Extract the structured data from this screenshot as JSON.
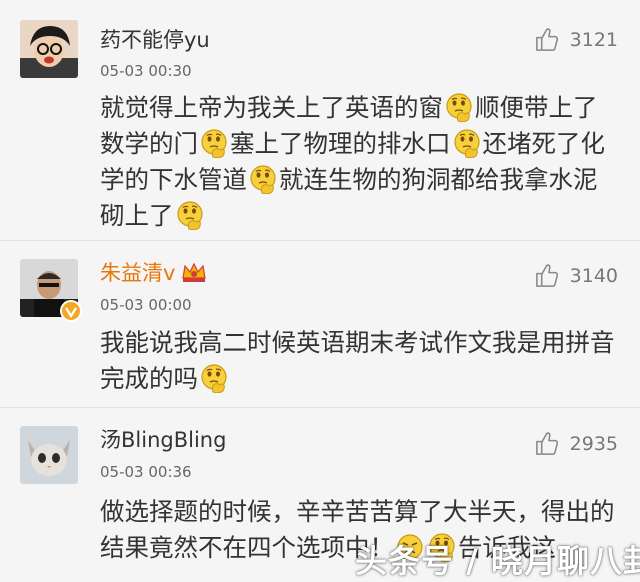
{
  "comments": [
    {
      "username": "药不能停yu",
      "time": "05-03 00:30",
      "likes": "3121",
      "text_parts": [
        "就觉得上帝为我关上了英语的窗",
        "顺便带上了数学的门",
        "塞上了物理的排水口",
        "还堵死了化学的下水管道",
        "就连生物的狗洞都给我拿水泥砌上了"
      ]
    },
    {
      "username": "朱益清v",
      "time": "05-03 00:00",
      "likes": "3140",
      "text_parts": [
        "我能说我高二时候英语期末考试作文我是用拼音完成的吗"
      ],
      "name_color": "#e8760c"
    },
    {
      "username": "汤BlingBling",
      "time": "05-03 00:36",
      "likes": "2935",
      "text_parts": [
        "做选择题的时候，辛辛苦苦算了大半天，得出的结果竟然不在四个选项中！",
        "告诉我这"
      ]
    }
  ],
  "watermark": "头条号 / 晓月聊八卦",
  "icons": {
    "like": "thumbs-up-icon",
    "emoji": "thinking-face-icon",
    "verified": "verified-v-icon",
    "vip": "crown-vip-icon"
  }
}
